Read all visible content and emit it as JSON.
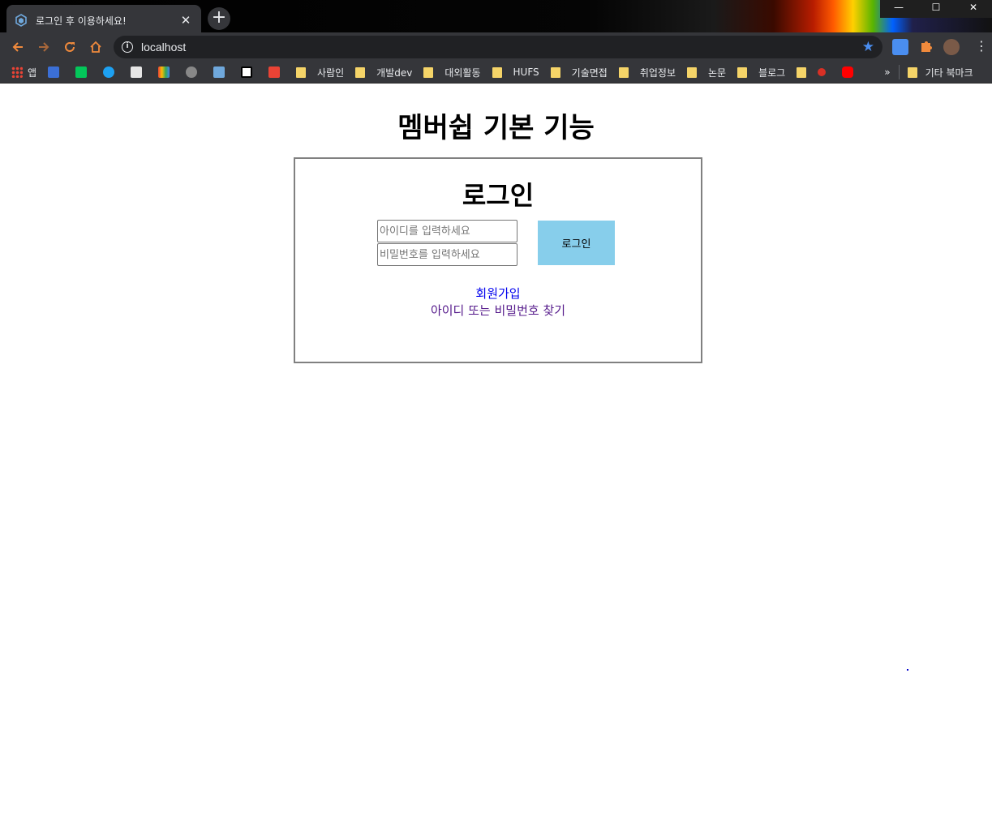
{
  "browser": {
    "tab_title": "로그인 후 이용하세요!",
    "tab_close": "✕",
    "new_tab": "+",
    "url": "localhost",
    "window_controls": [
      "—",
      "☐",
      "✕"
    ],
    "bookmarks": [
      {
        "label": "앱",
        "icon": "apps-grid-icon"
      },
      {
        "label": "",
        "icon": "jam-icon"
      },
      {
        "label": "",
        "icon": "naver-icon"
      },
      {
        "label": "",
        "icon": "edge-icon"
      },
      {
        "label": "",
        "icon": "face-icon"
      },
      {
        "label": "",
        "icon": "hand-icon"
      },
      {
        "label": "",
        "icon": "github-icon"
      },
      {
        "label": "",
        "icon": "cube-icon"
      },
      {
        "label": "",
        "icon": "notion-icon"
      },
      {
        "label": "",
        "icon": "gmail-icon"
      }
    ],
    "bookmark_folders": [
      "사람인",
      "개발dev",
      "대외활동",
      "HUFS",
      "기술면접",
      "취업정보",
      "논문",
      "블로그"
    ],
    "more_bookmarks": "»",
    "other_bookmarks": "기타 북마크"
  },
  "page": {
    "title": "멤버쉽 기본 기능",
    "login": {
      "heading": "로그인",
      "id_placeholder": "아이디를 입력하세요",
      "pw_placeholder": "비밀번호를 입력하세요",
      "login_button": "로그인",
      "signup_link": "회원가입",
      "find_link": "아이디 또는 비밀번호 찾기"
    }
  },
  "colors": {
    "login_button_bg": "#87ceeb",
    "link_unvisited": "#0000ee",
    "link_visited": "#551a8b"
  }
}
